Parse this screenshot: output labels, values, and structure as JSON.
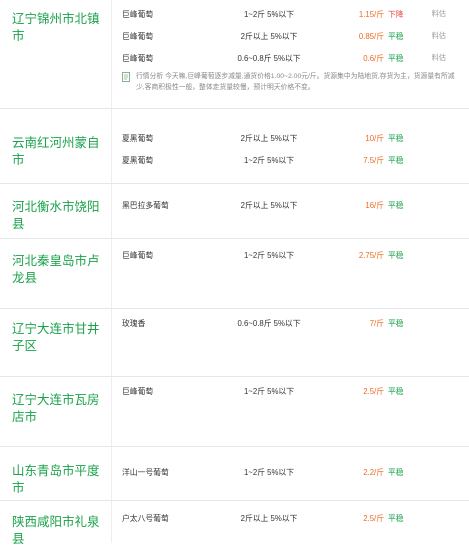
{
  "regions": [
    {
      "name": "辽宁锦州市北镇市",
      "rows": [
        {
          "variety": "巨峰葡萄",
          "spec": "1~2斤 5%以下",
          "price": "1.15/斤",
          "trend": "下降",
          "trend_dir": "down",
          "detail": "料估"
        },
        {
          "variety": "巨峰葡萄",
          "spec": "2斤以上 5%以下",
          "price": "0.85/斤",
          "trend": "平稳",
          "trend_dir": "flat",
          "detail": "料估"
        },
        {
          "variety": "巨峰葡萄",
          "spec": "0.6~0.8斤 5%以下",
          "price": "0.6/斤",
          "trend": "平稳",
          "trend_dir": "flat",
          "detail": "料估"
        }
      ],
      "analysis": "行情分析 今天嘛,巨峰葡萄逐步减量,通货价格1.00~2.00元/斤。货源集中为陆地货,存货为主，货源量有所减少,客商积极性一般，整体走货量较慢，预计明天价格不变。"
    },
    {
      "name": "云南红河州蒙自市",
      "rows": [
        {
          "variety": "夏黑葡萄",
          "spec": "2斤以上 5%以下",
          "price": "10/斤",
          "trend": "平稳",
          "trend_dir": "flat",
          "detail": ""
        },
        {
          "variety": "夏黑葡萄",
          "spec": "1~2斤 5%以下",
          "price": "7.5/斤",
          "trend": "平稳",
          "trend_dir": "flat",
          "detail": ""
        }
      ]
    },
    {
      "name": "河北衡水市饶阳县",
      "rows": [
        {
          "variety": "黑巴拉多葡萄",
          "spec": "2斤以上 5%以下",
          "price": "16/斤",
          "trend": "平稳",
          "trend_dir": "flat",
          "detail": ""
        }
      ]
    },
    {
      "name": "河北秦皇岛市卢龙县",
      "rows": [
        {
          "variety": "巨峰葡萄",
          "spec": "1~2斤 5%以下",
          "price": "2.75/斤",
          "trend": "平稳",
          "trend_dir": "flat",
          "detail": ""
        }
      ]
    },
    {
      "name": "辽宁大连市甘井子区",
      "rows": [
        {
          "variety": "玫瑰香",
          "spec": "0.6~0.8斤 5%以下",
          "price": "7/斤",
          "trend": "平稳",
          "trend_dir": "flat",
          "detail": ""
        }
      ]
    },
    {
      "name": "辽宁大连市瓦房店市",
      "rows": [
        {
          "variety": "巨峰葡萄",
          "spec": "1~2斤 5%以下",
          "price": "2.5/斤",
          "trend": "平稳",
          "trend_dir": "flat",
          "detail": ""
        }
      ]
    },
    {
      "name": "山东青岛市平度市",
      "rows": [
        {
          "variety": "洋山一号葡萄",
          "spec": "1~2斤 5%以下",
          "price": "2.2/斤",
          "trend": "平稳",
          "trend_dir": "flat",
          "detail": ""
        }
      ]
    },
    {
      "name": "陕西咸阳市礼泉县",
      "rows": [
        {
          "variety": "户太八号葡萄",
          "spec": "2斤以上 5%以下",
          "price": "2.5/斤",
          "trend": "平稳",
          "trend_dir": "flat",
          "detail": ""
        }
      ]
    }
  ],
  "colors": {
    "region": "#1aa24a",
    "price": "#ef6a1f",
    "flat": "#1aa24a",
    "down": "#e8443c"
  },
  "icons": {
    "analysis": "document-icon"
  }
}
